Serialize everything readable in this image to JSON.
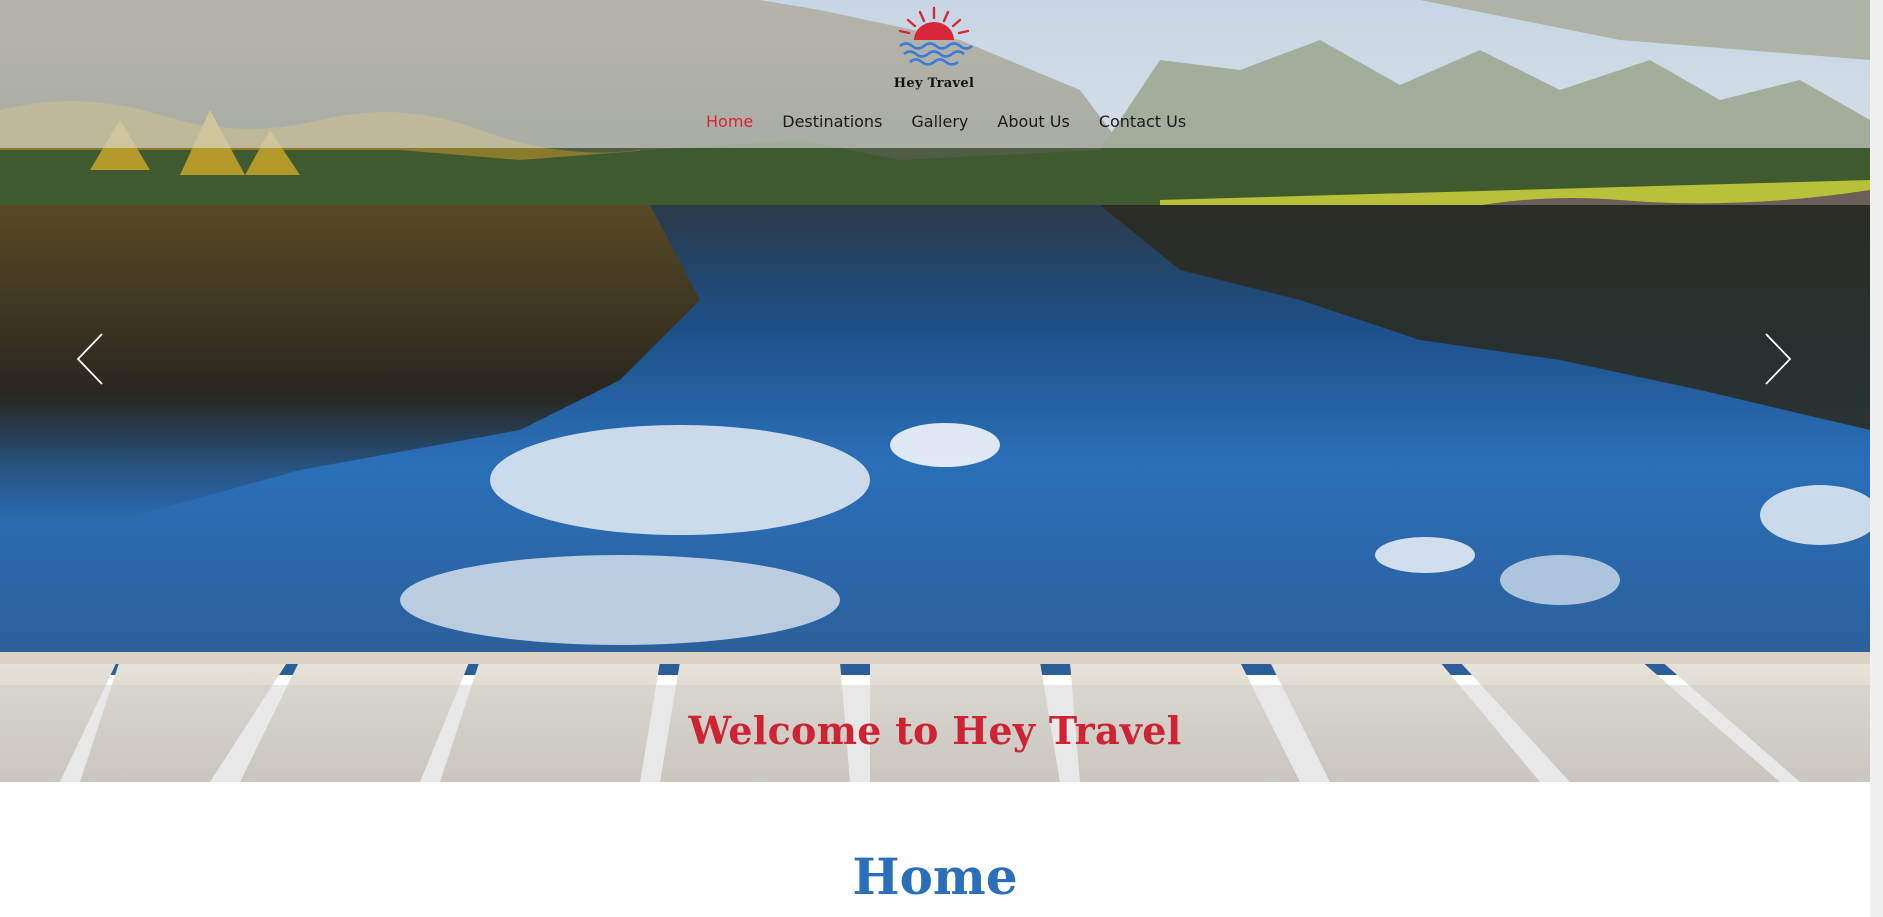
{
  "brand": {
    "name": "Hey Travel",
    "colors": {
      "accent_red": "#d8263a",
      "heading_blue": "#2a6fbb",
      "logo_blue": "#3a7bd5"
    }
  },
  "nav": {
    "items": [
      {
        "label": "Home",
        "active": true
      },
      {
        "label": "Destinations",
        "active": false
      },
      {
        "label": "Gallery",
        "active": false
      },
      {
        "label": "About Us",
        "active": false
      },
      {
        "label": "Contact Us",
        "active": false
      }
    ]
  },
  "slider": {
    "caption": "Welcome to Hey Travel",
    "prev_icon": "chevron-left-icon",
    "next_icon": "chevron-right-icon"
  },
  "section": {
    "title": "Home"
  }
}
